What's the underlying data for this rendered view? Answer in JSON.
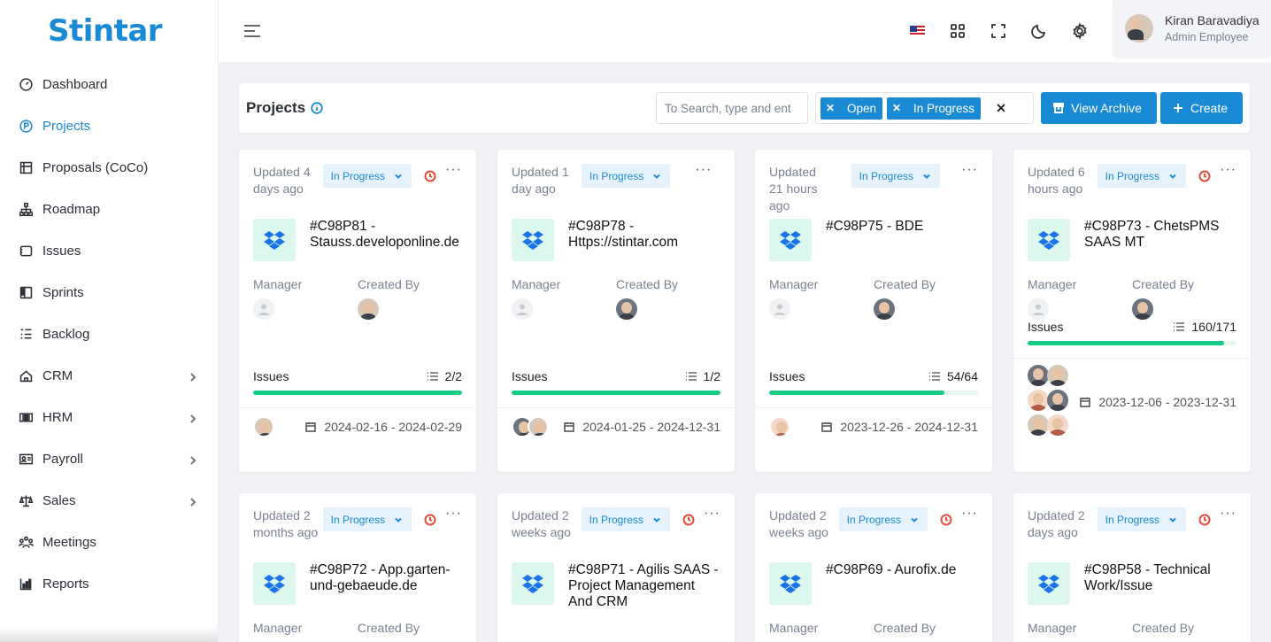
{
  "brand": {
    "name": "Stintar",
    "logo_text": "tintar",
    "logo_color": "#1a8ad4"
  },
  "sidebar": {
    "items": [
      {
        "label": "Dashboard",
        "icon": "dashboard-icon",
        "active": false,
        "chevron": false
      },
      {
        "label": "Projects",
        "icon": "projects-icon",
        "active": true,
        "chevron": false
      },
      {
        "label": "Proposals (CoCo)",
        "icon": "proposals-icon",
        "active": false,
        "chevron": false
      },
      {
        "label": "Roadmap",
        "icon": "roadmap-icon",
        "active": false,
        "chevron": false
      },
      {
        "label": "Issues",
        "icon": "issues-icon",
        "active": false,
        "chevron": false
      },
      {
        "label": "Sprints",
        "icon": "sprints-icon",
        "active": false,
        "chevron": false
      },
      {
        "label": "Backlog",
        "icon": "backlog-icon",
        "active": false,
        "chevron": false
      },
      {
        "label": "CRM",
        "icon": "crm-icon",
        "active": false,
        "chevron": true
      },
      {
        "label": "HRM",
        "icon": "hrm-icon",
        "active": false,
        "chevron": true
      },
      {
        "label": "Payroll",
        "icon": "payroll-icon",
        "active": false,
        "chevron": true
      },
      {
        "label": "Sales",
        "icon": "sales-icon",
        "active": false,
        "chevron": true
      },
      {
        "label": "Meetings",
        "icon": "meetings-icon",
        "active": false,
        "chevron": false
      },
      {
        "label": "Reports",
        "icon": "reports-icon",
        "active": false,
        "chevron": false
      }
    ]
  },
  "header": {
    "user_name": "Kiran Baravadiya",
    "user_role": "Admin Employee"
  },
  "toolbar": {
    "title": "Projects",
    "search_placeholder": "To Search, type and ent",
    "filters": [
      "Open",
      "In Progress"
    ],
    "archive_label": "View Archive",
    "create_label": "Create"
  },
  "labels": {
    "manager": "Manager",
    "created_by": "Created By",
    "issues": "Issues"
  },
  "accent_colors": {
    "primary": "#1a8ad4",
    "progress": "#13cb83",
    "overdue": "#e74c3c"
  },
  "cards": [
    {
      "updated": "Updated 4 days ago",
      "status": "In Progress",
      "overdue": true,
      "name": "#C98P81 - Stauss.developonline.de",
      "issues": "2/2",
      "progress": 1.0,
      "dates": "2024-02-16 - 2024-02-29"
    },
    {
      "updated": "Updated 1 day ago",
      "status": "In Progress",
      "overdue": false,
      "name": "#C98P78 - Https://stintar.com",
      "issues": "1/2",
      "progress": 1.0,
      "dates": "2024-01-25 - 2024-12-31"
    },
    {
      "updated": "Updated 21 hours ago",
      "status": "In Progress",
      "overdue": false,
      "name": "#C98P75 - BDE",
      "issues": "54/64",
      "progress": 0.84,
      "dates": "2023-12-26 - 2024-12-31"
    },
    {
      "updated": "Updated 6 hours ago",
      "status": "In Progress",
      "overdue": true,
      "name": "#C98P73 - ChetsPMS SAAS MT",
      "issues": "160/171",
      "progress": 0.94,
      "dates": "2023-12-06 - 2023-12-31"
    },
    {
      "updated": "Updated 2 months ago",
      "status": "In Progress",
      "overdue": true,
      "name": "#C98P72 - App.garten-und-gebaeude.de"
    },
    {
      "updated": "Updated 2 weeks ago",
      "status": "In Progress",
      "overdue": true,
      "name": "#C98P71 - Agilis SAAS - Project Management And CRM"
    },
    {
      "updated": "Updated 2 weeks ago",
      "status": "In Progress",
      "overdue": true,
      "name": "#C98P69 - Aurofix.de"
    },
    {
      "updated": "Updated 2 days ago",
      "status": "In Progress",
      "overdue": true,
      "name": "#C98P58 - Technical Work/Issue"
    }
  ]
}
